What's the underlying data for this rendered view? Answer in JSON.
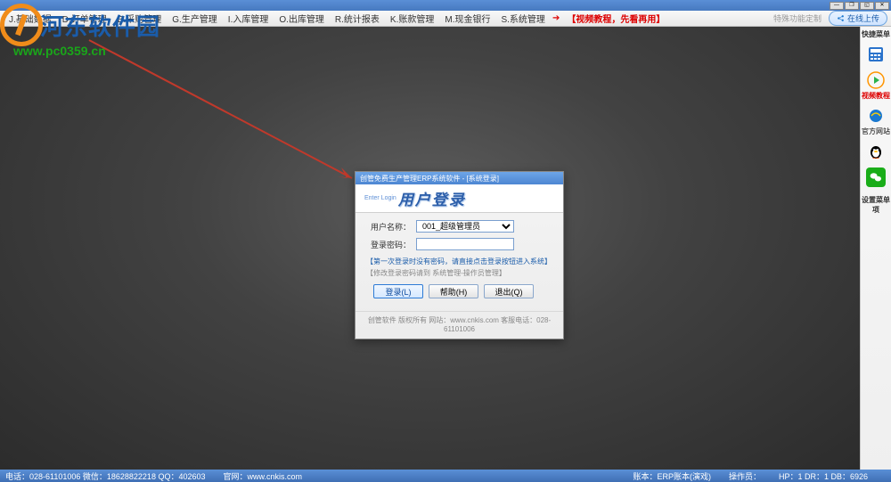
{
  "menubar": {
    "items": [
      "J.基础数据",
      "D.订单管理",
      "B.采购管理",
      "G.生产管理",
      "I.入库管理",
      "O.出库管理",
      "R.统计报表",
      "K.账款管理",
      "M.现金银行",
      "S.系统管理"
    ],
    "promo": "【视频教程，先看再用】",
    "misc": "特殊功能定制",
    "upload": "在线上传"
  },
  "watermark": {
    "site_name": "河东软件园",
    "url": "www.pc0359.cn"
  },
  "login": {
    "title": "创管免费生产管理ERP系统软件 - [系统登录]",
    "banner_small": "Enter Login",
    "banner_big": "用户登录",
    "username_label": "用户名称：",
    "username_value": "001_超级管理员",
    "password_label": "登录密码：",
    "note1": "【第一次登录时没有密码，请直接点击登录按钮进入系统】",
    "note2": "【修改登录密码请到 系统管理-操作员管理】",
    "btn_login": "登录(L)",
    "btn_help": "帮助(H)",
    "btn_exit": "退出(Q)",
    "footer": "创管软件 版权所有 网站：www.cnkis.com  客服电话：028-61101006"
  },
  "sidebar": {
    "header": "快捷菜单",
    "footer_item": "设置菜单项",
    "items": [
      {
        "icon": "calculator",
        "label": "",
        "color": "#2a73cc"
      },
      {
        "icon": "play",
        "label": "视频教程",
        "color": "#d00",
        "red": true
      },
      {
        "icon": "ie",
        "label": "官方网站",
        "color": "#1a78cf"
      },
      {
        "icon": "qq",
        "label": "",
        "color": "#000"
      },
      {
        "icon": "wechat",
        "label": "",
        "color": "#1aad19"
      }
    ]
  },
  "statusbar": {
    "contact": "电话：028-61101006 微信：18628822218 QQ：402603",
    "site": "官网：www.cnkis.com",
    "account": "账本：ERP账本(演戏)",
    "operator": "操作员：",
    "db": "HP：1 DR：1 DB：6926"
  }
}
